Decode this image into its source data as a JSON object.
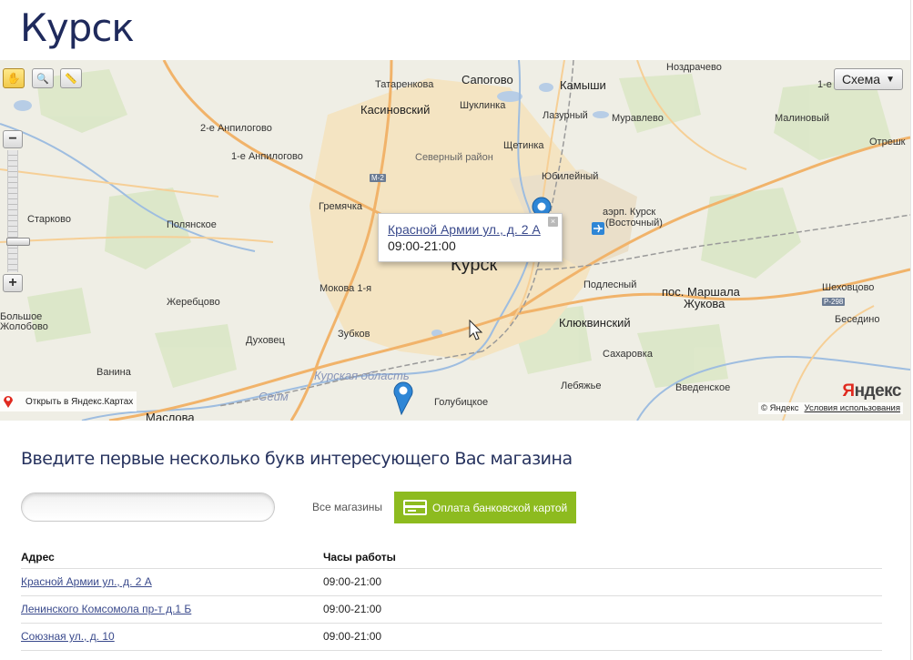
{
  "page": {
    "title": "Курск"
  },
  "map": {
    "tools": [
      {
        "name": "hand-tool-icon",
        "glyph": "✋"
      },
      {
        "name": "zoom-area-tool-icon",
        "glyph": "🔍"
      },
      {
        "name": "ruler-tool-icon",
        "glyph": "📏"
      }
    ],
    "layer_label": "Схема",
    "zoom_in": "+",
    "zoom_out": "−",
    "labels": {
      "l1": "Татаренкова",
      "l2": "Сапогово",
      "l3": "Камыши",
      "l4": "Ноздрачево",
      "l5": "1-е",
      "l6": "Касиновский",
      "l7": "Шуклинка",
      "l8": "Лазурный",
      "l9": "Муравлево",
      "l10": "Малиновый",
      "l11": "2-е Анпилогово",
      "l12": "Щетинка",
      "l13": "Отрешк",
      "l14": "1-е Анпилогово",
      "l15": "Северный район",
      "l16": "Юбилейный",
      "l17": "Гремячка",
      "l18": "аэрп. Курск",
      "l19": "(Восточный)",
      "l20": "Старково",
      "l21": "Полянское",
      "l22": "Курск",
      "l23": "Подлесный",
      "l24": "пос. Маршала",
      "l25": "Жукова",
      "l26": "Шеховцово",
      "l27": "Мокова 1-я",
      "l28": "Жеребцово",
      "l29": "Клюквинский",
      "l30": "Беседино",
      "l31": "Большое",
      "l32": "Жолобово",
      "l33": "Духовец",
      "l34": "Зубков",
      "l35": "Сахаровка",
      "l36": "Ванина",
      "l37": "Курская область",
      "l38": "Лебяжье",
      "l39": "Введенское",
      "l40": "Сейм",
      "l41": "Голубицкое",
      "l42": "Маслова"
    },
    "road_badges": {
      "m2": "M-2",
      "r298": "P-298"
    },
    "balloon": {
      "address": "Красной Армии ул., д. 2 А",
      "hours": "09:00-21:00",
      "close": "×"
    },
    "open_in_yandex": "Открыть в Яндекс.Картах",
    "logo": {
      "first": "Я",
      "rest": "ндекс"
    },
    "copyright": "© Яндекс",
    "terms": "Условия использования",
    "accent_color": "#8dbb1f",
    "marker_color": "#2e86d6"
  },
  "search": {
    "prompt": "Введите первые несколько букв интересующего Вас магазина",
    "value": "",
    "placeholder": "",
    "all_stores": "Все магазины",
    "card_payment": "Оплата банковской картой"
  },
  "table": {
    "headers": {
      "address": "Адрес",
      "hours": "Часы работы"
    },
    "rows": [
      {
        "address": "Красной Армии ул., д. 2 А",
        "hours": "09:00-21:00"
      },
      {
        "address": "Ленинского Комсомола пр-т д.1 Б",
        "hours": "09:00-21:00"
      },
      {
        "address": "Союзная ул., д. 10",
        "hours": "09:00-21:00"
      }
    ]
  }
}
